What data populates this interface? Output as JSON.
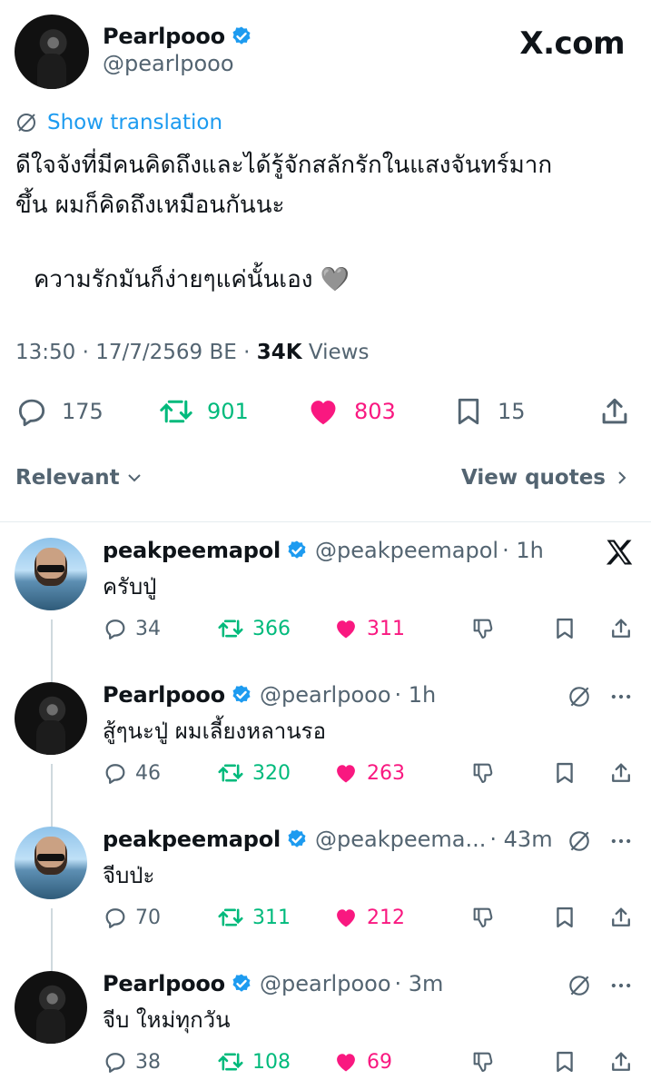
{
  "main_tweet": {
    "display_name": "Pearlpooo",
    "handle": "@pearlpooo",
    "site_label": "X.com",
    "show_translation": "Show translation",
    "text_line1": "ดีใจจังที่มีคนคิดถึงและได้รู้จักสลักรักในแสงจันทร์มาก",
    "text_line2": "ขึ้น  ผมก็คิดถึงเหมือนกันนะ",
    "text_line3": "ความรักมันก็ง่ายๆแค่นั้นเอง 🩶",
    "time": "13:50 · 17/7/2569 BE · ",
    "views_count": "34K",
    "views_label": " Views",
    "replies": "175",
    "reposts": "901",
    "likes": "803",
    "bookmarks": "15"
  },
  "filters": {
    "relevant": "Relevant",
    "view_quotes": "View quotes"
  },
  "colors": {
    "accent": "#1d9bf0",
    "repost": "#00ba7c",
    "like": "#f91880",
    "secondary": "#536471"
  },
  "replies": [
    {
      "display_name": "peakpeemapol",
      "handle": "@peakpeemapol",
      "time": "· 1h",
      "text": "ครับปู่",
      "replies": "34",
      "reposts": "366",
      "likes": "311"
    },
    {
      "display_name": "Pearlpooo",
      "handle": "@pearlpooo",
      "time": "· 1h",
      "text": "สู้ๆนะปู่ ผมเลี้ยงหลานรอ",
      "replies": "46",
      "reposts": "320",
      "likes": "263"
    },
    {
      "display_name": "peakpeemapol",
      "handle": "@peakpeema...",
      "time": "· 43m",
      "text": "จีบป่ะ",
      "replies": "70",
      "reposts": "311",
      "likes": "212"
    },
    {
      "display_name": "Pearlpooo",
      "handle": "@pearlpooo",
      "time": "· 3m",
      "text": "จีบ ใหม่ทุกวัน",
      "replies": "38",
      "reposts": "108",
      "likes": "69"
    }
  ]
}
